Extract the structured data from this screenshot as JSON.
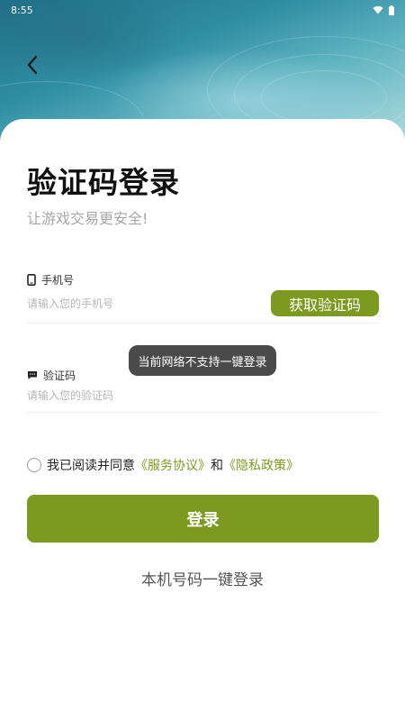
{
  "status_bar": {
    "time": "8:55",
    "icons": [
      "wifi-icon",
      "battery-icon"
    ]
  },
  "header": {
    "back_icon": "chevron-left-icon"
  },
  "page": {
    "title": "验证码登录",
    "subtitle": "让游戏交易更安全!"
  },
  "phone_field": {
    "icon": "phone-icon",
    "label": "手机号",
    "placeholder": "请输入您的手机号",
    "value": ""
  },
  "get_code_button": {
    "label": "获取验证码"
  },
  "code_field": {
    "icon": "message-icon",
    "label": "验证码",
    "placeholder": "请输入您的验证码",
    "value": ""
  },
  "toast": {
    "text": "当前网络不支持一键登录"
  },
  "agreement": {
    "checked": false,
    "prefix": "我已阅读并同意",
    "service_link": "《服务协议》",
    "conjunction": "和",
    "privacy_link": "《隐私政策》"
  },
  "login_button": {
    "label": "登录"
  },
  "one_key_login": {
    "label": "本机号码一键登录"
  },
  "colors": {
    "accent": "#7b9a1f",
    "toast_bg": "#4a4a4a",
    "title": "#111111",
    "placeholder": "#b5b5b5"
  }
}
